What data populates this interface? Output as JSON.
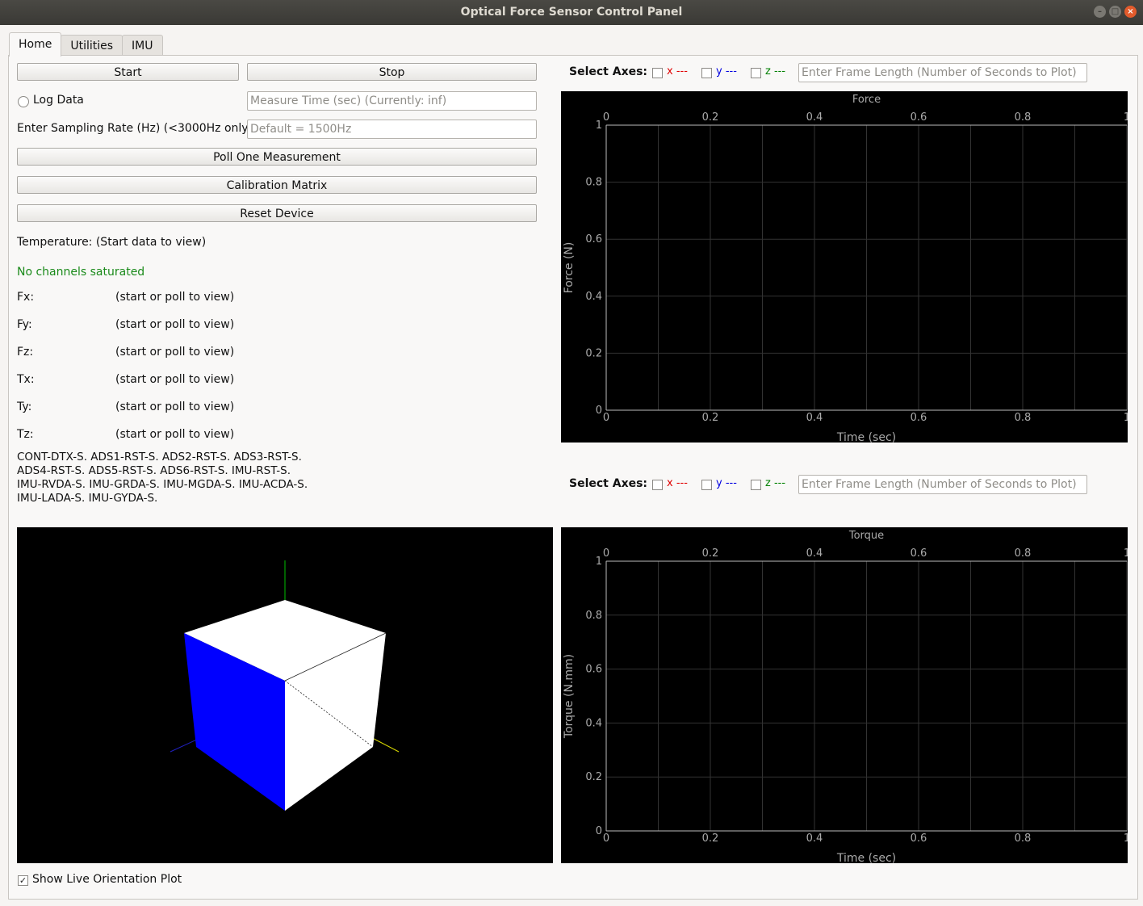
{
  "window": {
    "title": "Optical Force Sensor Control Panel"
  },
  "tabs": [
    "Home",
    "Utilities",
    "IMU"
  ],
  "controls": {
    "start": "Start",
    "stop": "Stop",
    "log_data": "Log Data",
    "measure_time_placeholder": "Measure Time (sec) (Currently: inf)",
    "sampling_rate_label": "Enter Sampling Rate (Hz) (<3000Hz only)",
    "sampling_rate_placeholder": "Default = 1500Hz",
    "poll": "Poll One Measurement",
    "calibration": "Calibration Matrix",
    "reset": "Reset Device"
  },
  "status": {
    "temperature": "Temperature: (Start data to view)",
    "saturation": "No channels saturated",
    "saturation_color": "#1a8a1a",
    "channels": [
      {
        "name": "Fx:",
        "value": "(start or poll to view)"
      },
      {
        "name": "Fy:",
        "value": "(start or poll to view)"
      },
      {
        "name": "Fz:",
        "value": "(start or poll to view)"
      },
      {
        "name": "Tx:",
        "value": "(start or poll to view)"
      },
      {
        "name": "Ty:",
        "value": "(start or poll to view)"
      },
      {
        "name": "Tz:",
        "value": "(start or poll to view)"
      }
    ],
    "device_flags": [
      "CONT-DTX-S. ADS1-RST-S. ADS2-RST-S. ADS3-RST-S.",
      "ADS4-RST-S. ADS5-RST-S. ADS6-RST-S. IMU-RST-S.",
      "IMU-RVDA-S. IMU-GRDA-S. IMU-MGDA-S. IMU-ACDA-S.",
      "IMU-LADA-S. IMU-GYDA-S."
    ]
  },
  "axes_select": {
    "label": "Select Axes:",
    "x": "x ---",
    "y": "y ---",
    "z": "z ---",
    "x_color": "#e00000",
    "y_color": "#0000e0",
    "z_color": "#008000",
    "frame_placeholder": "Enter Frame Length (Number of Seconds to Plot)"
  },
  "force_plot": {
    "chart_data": {
      "type": "line",
      "title": "Force",
      "xlabel": "Time (sec)",
      "ylabel": "Force (N)",
      "xlim": [
        0,
        1
      ],
      "ylim": [
        0,
        1
      ],
      "x_ticks": [
        "0",
        "0.2",
        "0.4",
        "0.6",
        "0.8",
        "1"
      ],
      "y_ticks": [
        "0",
        "0.2",
        "0.4",
        "0.6",
        "0.8",
        "1"
      ],
      "series": [],
      "grid": true
    }
  },
  "torque_plot": {
    "chart_data": {
      "type": "line",
      "title": "Torque",
      "xlabel": "Time (sec)",
      "ylabel": "Torque (N.mm)",
      "xlim": [
        0,
        1
      ],
      "ylim": [
        0,
        1
      ],
      "x_ticks": [
        "0",
        "0.2",
        "0.4",
        "0.6",
        "0.8",
        "1"
      ],
      "y_ticks": [
        "0",
        "0.2",
        "0.4",
        "0.6",
        "0.8",
        "1"
      ],
      "series": [],
      "grid": true
    }
  },
  "orientation": {
    "show_label": "Show Live Orientation Plot",
    "checked": true,
    "cube_face_color": "#0000ff"
  }
}
